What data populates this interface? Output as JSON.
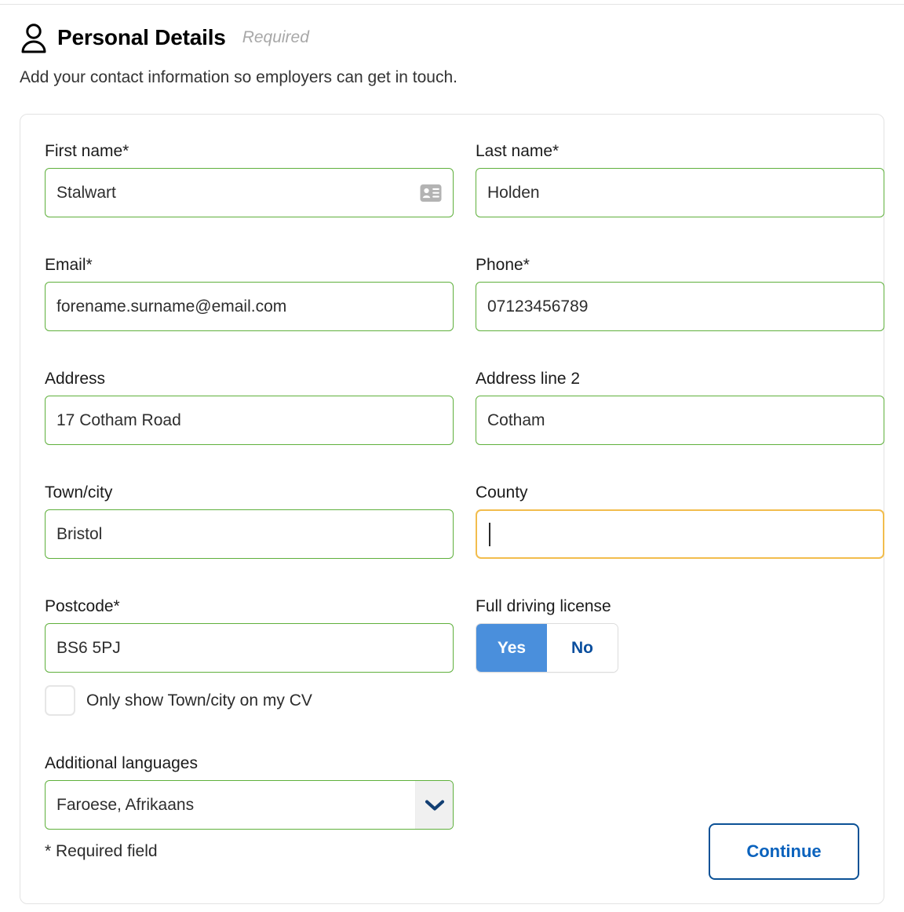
{
  "header": {
    "icon": "person-icon",
    "title": "Personal Details",
    "required_tag": "Required",
    "description": "Add your contact information so employers can get in touch."
  },
  "form": {
    "rows": [
      {
        "left": {
          "label": "First name*",
          "value": "Stalwart",
          "icon": "contact-card-icon",
          "state": "valid"
        },
        "right": {
          "label": "Last name*",
          "value": "Holden",
          "state": "valid"
        }
      },
      {
        "left": {
          "label": "Email*",
          "value": "forename.surname@email.com",
          "state": "valid"
        },
        "right": {
          "label": "Phone*",
          "value": "07123456789",
          "state": "valid"
        }
      },
      {
        "left": {
          "label": "Address",
          "value": "17 Cotham Road",
          "state": "valid"
        },
        "right": {
          "label": "Address line 2",
          "value": "Cotham",
          "state": "valid"
        }
      },
      {
        "left": {
          "label": "Town/city",
          "value": "Bristol",
          "state": "valid"
        },
        "right": {
          "label": "County",
          "value": "",
          "state": "focused"
        }
      }
    ],
    "postcode": {
      "label": "Postcode*",
      "value": "BS6 5PJ",
      "state": "valid"
    },
    "driving_license": {
      "label": "Full driving license",
      "options": [
        "Yes",
        "No"
      ],
      "selected": "Yes"
    },
    "town_only_checkbox": {
      "label": "Only show Town/city on my CV",
      "checked": false
    },
    "additional_languages": {
      "label": "Additional languages",
      "value": "Faroese, Afrikaans",
      "arrow_icon": "chevron-down-icon"
    }
  },
  "footer": {
    "required_note": "* Required field",
    "continue_label": "Continue"
  },
  "colors": {
    "valid_border": "#5fb03c",
    "focus_border": "#f2bd4d",
    "toggle_selected_bg": "#4a8fdc",
    "toggle_text_blue": "#0b4f9e",
    "button_border": "#0b5196",
    "button_text": "#0a62bd",
    "muted_text": "#a8a8a8"
  }
}
